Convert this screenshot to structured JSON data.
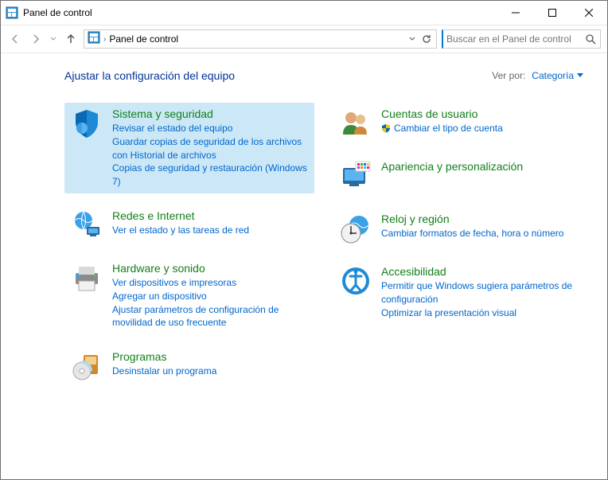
{
  "title": "Panel de control",
  "breadcrumb": "Panel de control",
  "search_placeholder": "Buscar en el Panel de control",
  "heading": "Ajustar la configuración del equipo",
  "view_by_label": "Ver por:",
  "view_by_value": "Categoría",
  "left": [
    {
      "title": "Sistema y seguridad",
      "links": [
        "Revisar el estado del equipo",
        "Guardar copias de seguridad de los archivos con Historial de archivos",
        "Copias de seguridad y restauración (Windows 7)"
      ]
    },
    {
      "title": "Redes e Internet",
      "links": [
        "Ver el estado y las tareas de red"
      ]
    },
    {
      "title": "Hardware y sonido",
      "links": [
        "Ver dispositivos e impresoras",
        "Agregar un dispositivo",
        "Ajustar parámetros de configuración de movilidad de uso frecuente"
      ]
    },
    {
      "title": "Programas",
      "links": [
        "Desinstalar un programa"
      ]
    }
  ],
  "right": [
    {
      "title": "Cuentas de usuario",
      "links": [
        "Cambiar el tipo de cuenta"
      ]
    },
    {
      "title": "Apariencia y personalización",
      "links": []
    },
    {
      "title": "Reloj y región",
      "links": [
        "Cambiar formatos de fecha, hora o número"
      ]
    },
    {
      "title": "Accesibilidad",
      "links": [
        "Permitir que Windows sugiera parámetros de configuración",
        "Optimizar la presentación visual"
      ]
    }
  ]
}
